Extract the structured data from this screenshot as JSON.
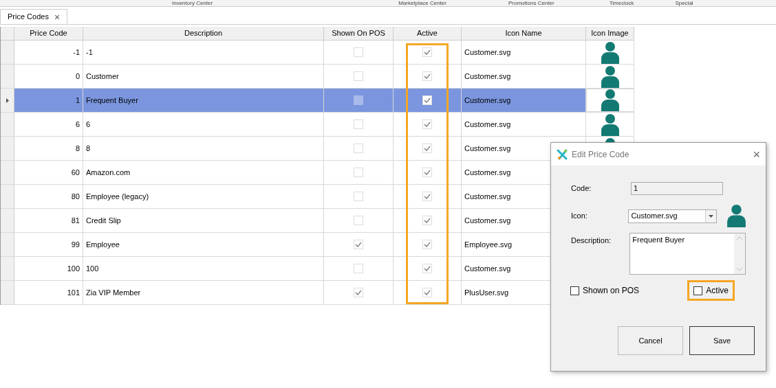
{
  "top_menu": [
    "Inventory Center",
    "Marketplace Center",
    "Promotions Center",
    "Timeclock",
    "Special"
  ],
  "tabs": [
    {
      "label": "Price Codes",
      "close": "×",
      "selected": true
    }
  ],
  "table": {
    "columns": [
      "Price Code",
      "Description",
      "Shown On POS",
      "Active",
      "Icon Name",
      "Icon Image"
    ],
    "rows": [
      {
        "price_code": "-1",
        "description": "-1",
        "shown_on_pos": false,
        "active": true,
        "icon_name": "Customer.svg",
        "kind": "with_icon",
        "selected": false
      },
      {
        "price_code": "0",
        "description": "Customer",
        "shown_on_pos": false,
        "active": true,
        "icon_name": "Customer.svg",
        "kind": "with_icon",
        "selected": false
      },
      {
        "price_code": "1",
        "description": "Frequent Buyer",
        "shown_on_pos": false,
        "active": true,
        "icon_name": "Customer.svg",
        "kind": "with_icon",
        "selected": true
      },
      {
        "price_code": "6",
        "description": "6",
        "shown_on_pos": false,
        "active": true,
        "icon_name": "Customer.svg",
        "kind": "with_icon",
        "selected": false
      },
      {
        "price_code": "8",
        "description": "8",
        "shown_on_pos": false,
        "active": true,
        "icon_name": "Customer.svg",
        "kind": "icon_cut",
        "selected": false
      },
      {
        "price_code": "60",
        "description": "Amazon.com",
        "shown_on_pos": false,
        "active": true,
        "icon_name": "Customer.svg",
        "selected": false
      },
      {
        "price_code": "80",
        "description": "Employee (legacy)",
        "shown_on_pos": false,
        "active": true,
        "icon_name": "Customer.svg",
        "selected": false
      },
      {
        "price_code": "81",
        "description": "Credit Slip",
        "shown_on_pos": false,
        "active": true,
        "icon_name": "Customer.svg",
        "selected": false
      },
      {
        "price_code": "99",
        "description": "Employee",
        "shown_on_pos": true,
        "active": true,
        "icon_name": "Employee.svg",
        "selected": false
      },
      {
        "price_code": "100",
        "description": "100",
        "shown_on_pos": false,
        "active": true,
        "icon_name": "Customer.svg",
        "selected": false
      },
      {
        "price_code": "101",
        "description": "Zia VIP Member",
        "shown_on_pos": true,
        "active": true,
        "icon_name": "PlusUser.svg",
        "selected": false
      }
    ]
  },
  "dialog": {
    "title": "Edit Price Code",
    "close": "×",
    "code_label": "Code:",
    "code_value": "1",
    "icon_label": "Icon:",
    "icon_value": "Customer.svg",
    "description_label": "Description:",
    "description_value": "Frequent Buyer",
    "shown_on_pos": {
      "label": "Shown on POS",
      "checked": false
    },
    "active": {
      "label": "Active",
      "checked": false,
      "highlighted": true
    },
    "buttons": [
      {
        "label": "Cancel",
        "default": false
      },
      {
        "label": "Save",
        "default": true
      }
    ]
  }
}
